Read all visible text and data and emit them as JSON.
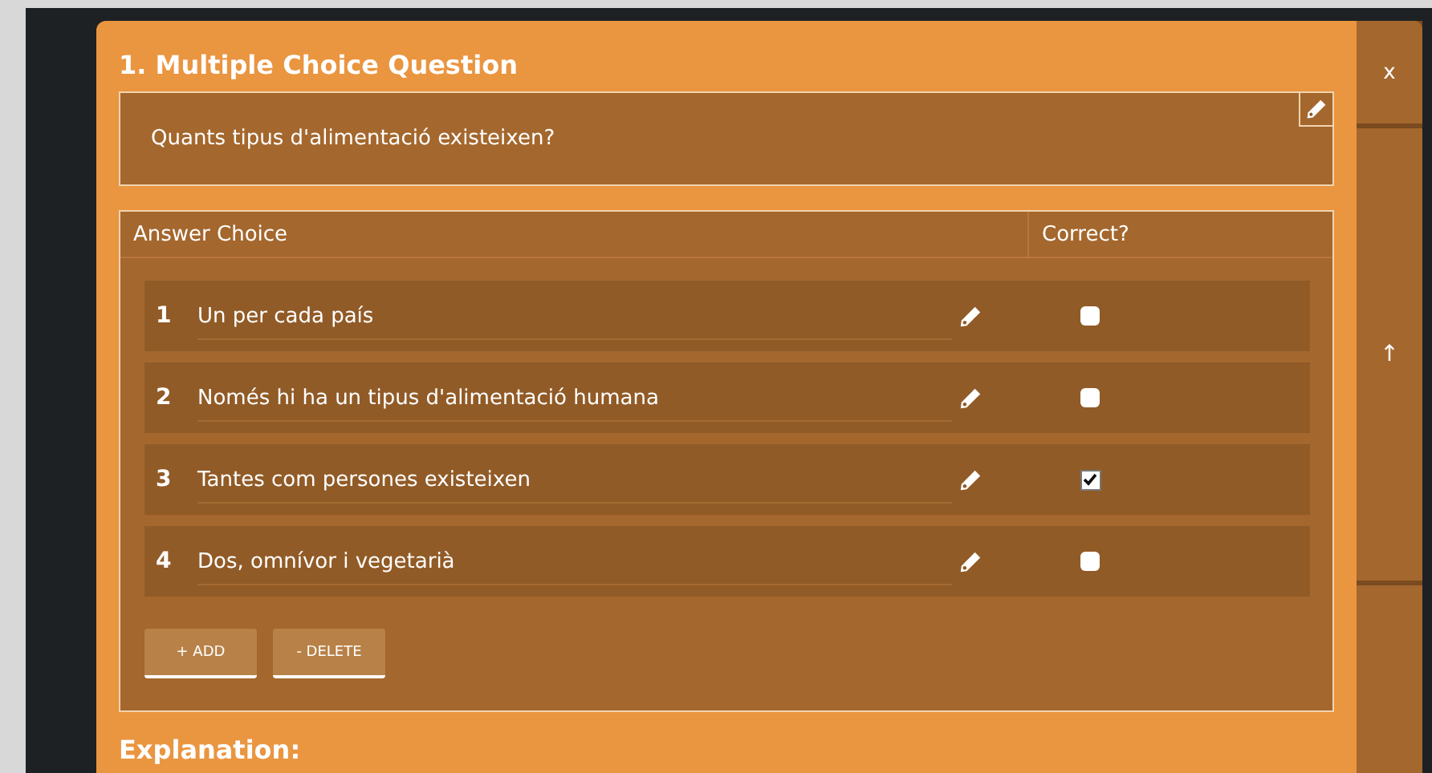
{
  "question": {
    "title": "1. Multiple Choice Question",
    "text": "Quants tipus d'alimentació existeixen?"
  },
  "table": {
    "columns": [
      "Answer Choice",
      "Correct?"
    ],
    "rows": [
      {
        "number": "1",
        "answer": "Un per cada país",
        "checked": false
      },
      {
        "number": "2",
        "answer": "Només hi ha un tipus d'alimentació humana",
        "checked": false
      },
      {
        "number": "3",
        "answer": "Tantes com persones existeixen",
        "checked": true
      },
      {
        "number": "4",
        "answer": "Dos, omnívor i vegetarià",
        "checked": false
      }
    ]
  },
  "buttons": [
    "+ ADD",
    "- DELETE"
  ],
  "explanation_heading": "Explanation:",
  "side_buttons": [
    "x",
    "↑"
  ]
}
